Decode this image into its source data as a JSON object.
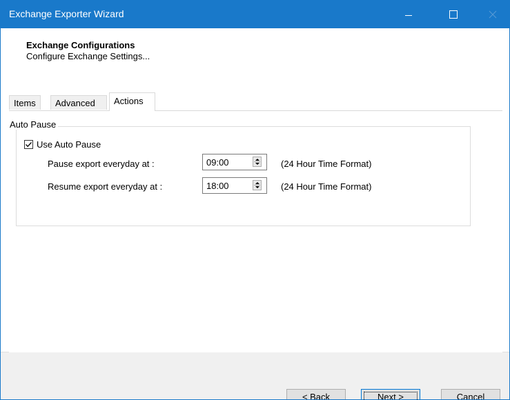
{
  "window": {
    "title": "Exchange Exporter Wizard"
  },
  "header": {
    "title": "Exchange Configurations",
    "subtitle": "Configure Exchange Settings..."
  },
  "tabs": [
    {
      "label": "Items",
      "active": false
    },
    {
      "label": "Advanced",
      "active": false
    },
    {
      "label": "Actions",
      "active": true
    }
  ],
  "auto_pause": {
    "group_label": "Auto Pause",
    "checkbox_label": "Use Auto Pause",
    "checked": true,
    "pause_label": "Pause export everyday at :",
    "pause_value": "09:00",
    "resume_label": "Resume export everyday at :",
    "resume_value": "18:00",
    "format_hint": "(24 Hour Time Format)"
  },
  "footer": {
    "back_label": "< Back",
    "next_label": "Next >",
    "cancel_label": "Cancel"
  },
  "colors": {
    "titlebar": "#1979ca",
    "footer": "#f0f0f0",
    "button": "#e1e1e1",
    "focus_border": "#0078d7"
  }
}
